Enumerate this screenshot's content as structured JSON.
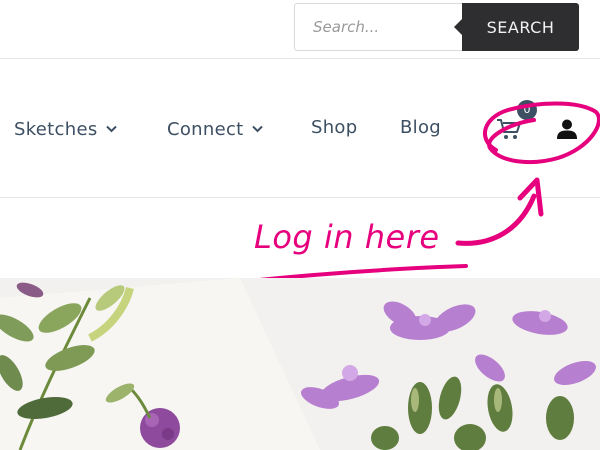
{
  "search": {
    "placeholder": "Search...",
    "value": "",
    "button_label": "SEARCH"
  },
  "nav": {
    "items": [
      {
        "label": "Sketches",
        "has_dropdown": true
      },
      {
        "label": "Connect",
        "has_dropdown": true
      },
      {
        "label": "Shop",
        "has_dropdown": false
      },
      {
        "label": "Blog",
        "has_dropdown": false
      }
    ],
    "cart": {
      "icon": "cart-icon",
      "badge": "0"
    },
    "account": {
      "icon": "user-icon"
    }
  },
  "annotation": {
    "text": "Log in here",
    "color": "#e6007e"
  },
  "hero": {
    "description_icon": "watercolor-flowers-image"
  },
  "colors": {
    "nav_text": "#3d4f63",
    "search_button": "#2e2e30",
    "annotation": "#e6007e"
  }
}
